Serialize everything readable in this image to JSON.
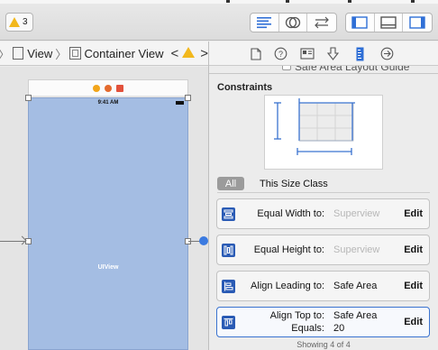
{
  "toolbar": {
    "warning_count": "3",
    "editor_modes": [
      "standard-editor-icon",
      "assistant-editor-icon",
      "version-editor-icon"
    ],
    "panels": [
      "navigator-panel-icon",
      "debug-panel-icon",
      "utilities-panel-icon"
    ]
  },
  "jumpbar": {
    "crumbs": [
      "View",
      "Container View"
    ]
  },
  "canvas": {
    "status_time": "9:41 AM",
    "view_label": "UIView"
  },
  "inspector": {
    "tabs": [
      "file-inspector-icon",
      "quick-help-icon",
      "identity-inspector-icon",
      "attributes-inspector-icon",
      "size-inspector-icon",
      "connections-inspector-icon"
    ],
    "partial_text": "Safe Area Layout Guide",
    "section_title": "Constraints",
    "scope_all": "All",
    "scope_class": "This Size Class",
    "constraints": [
      {
        "label": "Equal Width to:",
        "value": "Superview",
        "value_dim": true,
        "edit": "Edit"
      },
      {
        "label": "Equal Height to:",
        "value": "Superview",
        "value_dim": true,
        "edit": "Edit"
      },
      {
        "label": "Align Leading to:",
        "value": "Safe Area",
        "value_dim": false,
        "edit": "Edit"
      },
      {
        "label": "Align Top to:",
        "value": "Safe Area",
        "label2": "Equals:",
        "value2": "20",
        "edit": "Edit"
      }
    ],
    "footer": "Showing 4 of 4"
  },
  "colors": {
    "accent": "#2a5bb5",
    "selected_border": "#3a73d0",
    "view_fill": "#a4bde3",
    "warning": "#f2b81c"
  }
}
